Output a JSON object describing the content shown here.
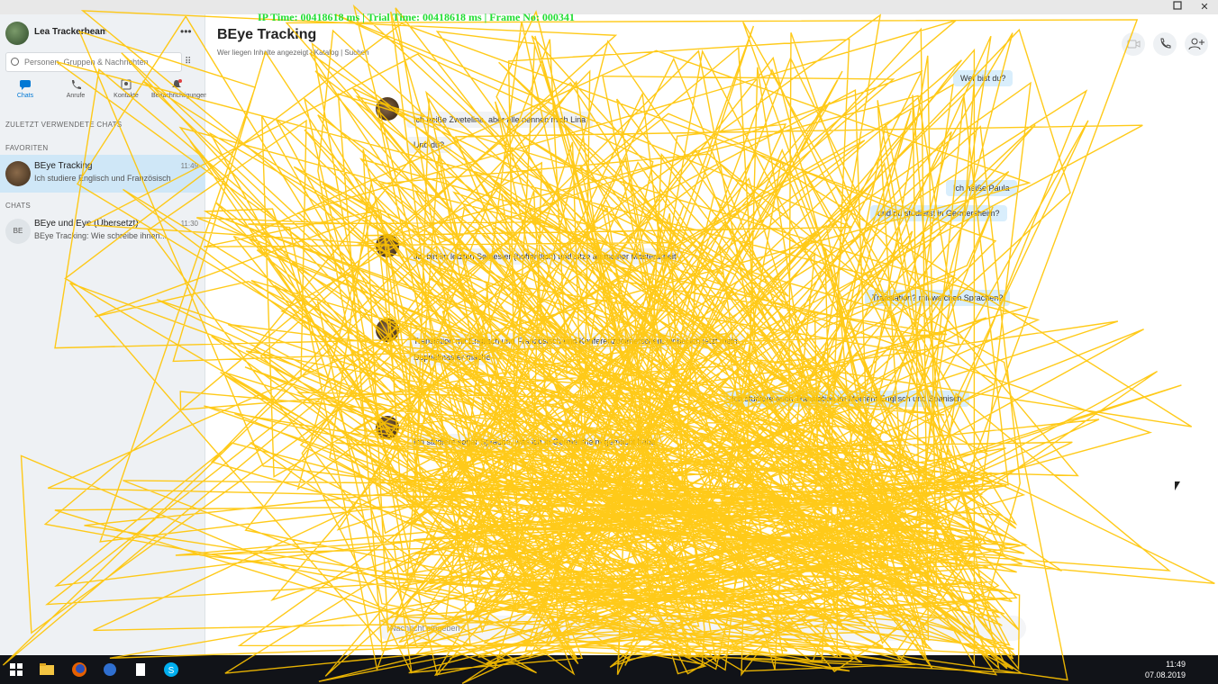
{
  "window": {
    "maximize_icon": "maximize-icon",
    "close_label": "✕"
  },
  "overlay": {
    "text": "IP Time: 00418618 ms | Trial Time: 00418618 ms | Frame No: 000341",
    "color": "#22dd33"
  },
  "sidebar": {
    "profile_name": "Lea Trackerbeam",
    "search_placeholder": "Personen, Gruppen & Nachrichten",
    "tabs": [
      {
        "label": "Chats",
        "icon": "chat-icon"
      },
      {
        "label": "Anrufe",
        "icon": "phone-icon"
      },
      {
        "label": "Kontakte",
        "icon": "contacts-icon"
      },
      {
        "label": "Benachrichtigungen",
        "icon": "bell-icon"
      }
    ],
    "recent_label": "ZULETZT VERWENDETE CHATS",
    "favorites_label": "FAVORITEN",
    "chats_label": "CHATS",
    "favorites": [
      {
        "title": "BEye Tracking",
        "snippet": "Ich studiere Englisch und Französisch",
        "time": "11:49"
      }
    ],
    "chats": [
      {
        "title": "BEye und Eye (Übersetzt)",
        "snippet": "BEye Tracking: Wie schreibe ihnen...",
        "time": "11:30"
      }
    ]
  },
  "conversation": {
    "title": "BEye Tracking",
    "subtitle": "Wer liegen Inhalte angezeigt | Katalog | Suchen",
    "messages_out": [
      {
        "text": "Wer bist du?"
      },
      {
        "text": "Ich heiße Paula"
      },
      {
        "text": "und du studierst in Germersheim?"
      },
      {
        "text": "Translation? mit welchen Sprachen?"
      },
      {
        "text": "Ich studiere auch Translation im Moment Englisch und Spanisch"
      }
    ],
    "messages_in": [
      {
        "text": "Ich heiße Zwetelina, aber alle nennen mich Lina"
      },
      {
        "text": "Und du?"
      },
      {
        "text": "Ja, bin im letzten Semester (hoffentlich) und sitze an meiner Masterarbeit"
      },
      {
        "text": "Translation mit Englisch und Französisch und Konferenzdolmetschen, wobei ich jetzt mein"
      },
      {
        "text": "Doppelmaster mache"
      },
      {
        "text": "Ich studiere sogar Sprache, was ich in Germersheim gemacht habe"
      }
    ],
    "compose_placeholder": "Nachricht eingeben"
  },
  "header_buttons": [
    {
      "icon": "video-call-icon"
    },
    {
      "icon": "phone-icon"
    },
    {
      "icon": "add-person-icon"
    }
  ],
  "taskbar": {
    "time": "11:49",
    "date": "07.08.2019",
    "icons": [
      "windows-start-icon",
      "file-explorer-icon",
      "firefox-icon",
      "app-icon",
      "document-icon",
      "skype-icon"
    ]
  }
}
